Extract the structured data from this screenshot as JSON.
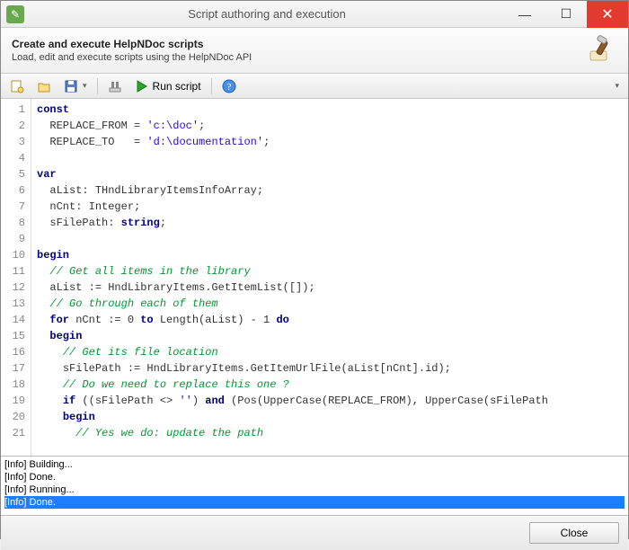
{
  "window": {
    "title": "Script authoring and execution"
  },
  "header": {
    "title": "Create and execute HelpNDoc scripts",
    "subtitle": "Load, edit and execute scripts using the HelpNDoc API"
  },
  "toolbar": {
    "run_label": "Run script"
  },
  "code": {
    "lines": [
      {
        "n": 1,
        "tokens": [
          [
            "kw",
            "const"
          ]
        ]
      },
      {
        "n": 2,
        "tokens": [
          [
            "sp",
            "  "
          ],
          [
            "id",
            "REPLACE_FROM = "
          ],
          [
            "str",
            "'c:\\doc'"
          ],
          [
            "id",
            ";"
          ]
        ]
      },
      {
        "n": 3,
        "tokens": [
          [
            "sp",
            "  "
          ],
          [
            "id",
            "REPLACE_TO   = "
          ],
          [
            "str",
            "'d:\\documentation'"
          ],
          [
            "id",
            ";"
          ]
        ]
      },
      {
        "n": 4,
        "tokens": []
      },
      {
        "n": 5,
        "tokens": [
          [
            "kw",
            "var"
          ]
        ]
      },
      {
        "n": 6,
        "tokens": [
          [
            "sp",
            "  "
          ],
          [
            "id",
            "aList: THndLibraryItemsInfoArray;"
          ]
        ]
      },
      {
        "n": 7,
        "tokens": [
          [
            "sp",
            "  "
          ],
          [
            "id",
            "nCnt: Integer;"
          ]
        ]
      },
      {
        "n": 8,
        "tokens": [
          [
            "sp",
            "  "
          ],
          [
            "id",
            "sFilePath: "
          ],
          [
            "kw",
            "string"
          ],
          [
            "id",
            ";"
          ]
        ]
      },
      {
        "n": 9,
        "tokens": []
      },
      {
        "n": 10,
        "tokens": [
          [
            "kw",
            "begin"
          ]
        ]
      },
      {
        "n": 11,
        "tokens": [
          [
            "sp",
            "  "
          ],
          [
            "cm",
            "// Get all items in the library"
          ]
        ]
      },
      {
        "n": 12,
        "tokens": [
          [
            "sp",
            "  "
          ],
          [
            "id",
            "aList := HndLibraryItems.GetItemList([]);"
          ]
        ]
      },
      {
        "n": 13,
        "tokens": [
          [
            "sp",
            "  "
          ],
          [
            "cm",
            "// Go through each of them"
          ]
        ]
      },
      {
        "n": 14,
        "tokens": [
          [
            "sp",
            "  "
          ],
          [
            "kw",
            "for"
          ],
          [
            "id",
            " nCnt := 0 "
          ],
          [
            "kw",
            "to"
          ],
          [
            "id",
            " Length(aList) - 1 "
          ],
          [
            "kw",
            "do"
          ]
        ]
      },
      {
        "n": 15,
        "tokens": [
          [
            "sp",
            "  "
          ],
          [
            "kw",
            "begin"
          ]
        ]
      },
      {
        "n": 16,
        "tokens": [
          [
            "sp",
            "    "
          ],
          [
            "cm",
            "// Get its file location"
          ]
        ]
      },
      {
        "n": 17,
        "tokens": [
          [
            "sp",
            "    "
          ],
          [
            "id",
            "sFilePath := HndLibraryItems.GetItemUrlFile(aList[nCnt].id);"
          ]
        ]
      },
      {
        "n": 18,
        "tokens": [
          [
            "sp",
            "    "
          ],
          [
            "cm",
            "// Do we need to replace this one ?"
          ]
        ]
      },
      {
        "n": 19,
        "tokens": [
          [
            "sp",
            "    "
          ],
          [
            "kw",
            "if"
          ],
          [
            "id",
            " ((sFilePath <> "
          ],
          [
            "str",
            "''"
          ],
          [
            "id",
            ") "
          ],
          [
            "kw",
            "and"
          ],
          [
            "id",
            " (Pos(UpperCase(REPLACE_FROM), UpperCase(sFilePath"
          ]
        ]
      },
      {
        "n": 20,
        "tokens": [
          [
            "sp",
            "    "
          ],
          [
            "kw",
            "begin"
          ]
        ]
      },
      {
        "n": 21,
        "tokens": [
          [
            "sp",
            "      "
          ],
          [
            "cm",
            "// Yes we do: update the path"
          ]
        ]
      }
    ]
  },
  "output": {
    "lines": [
      {
        "text": "[Info] Building...",
        "selected": false
      },
      {
        "text": "[Info] Done.",
        "selected": false
      },
      {
        "text": "[Info] Running...",
        "selected": false
      },
      {
        "text": "[Info] Done.",
        "selected": true
      }
    ]
  },
  "footer": {
    "close_label": "Close"
  },
  "colors": {
    "keyword": "#000088",
    "string": "#2a00ff",
    "comment": "#009933",
    "selection": "#1a7fff"
  }
}
